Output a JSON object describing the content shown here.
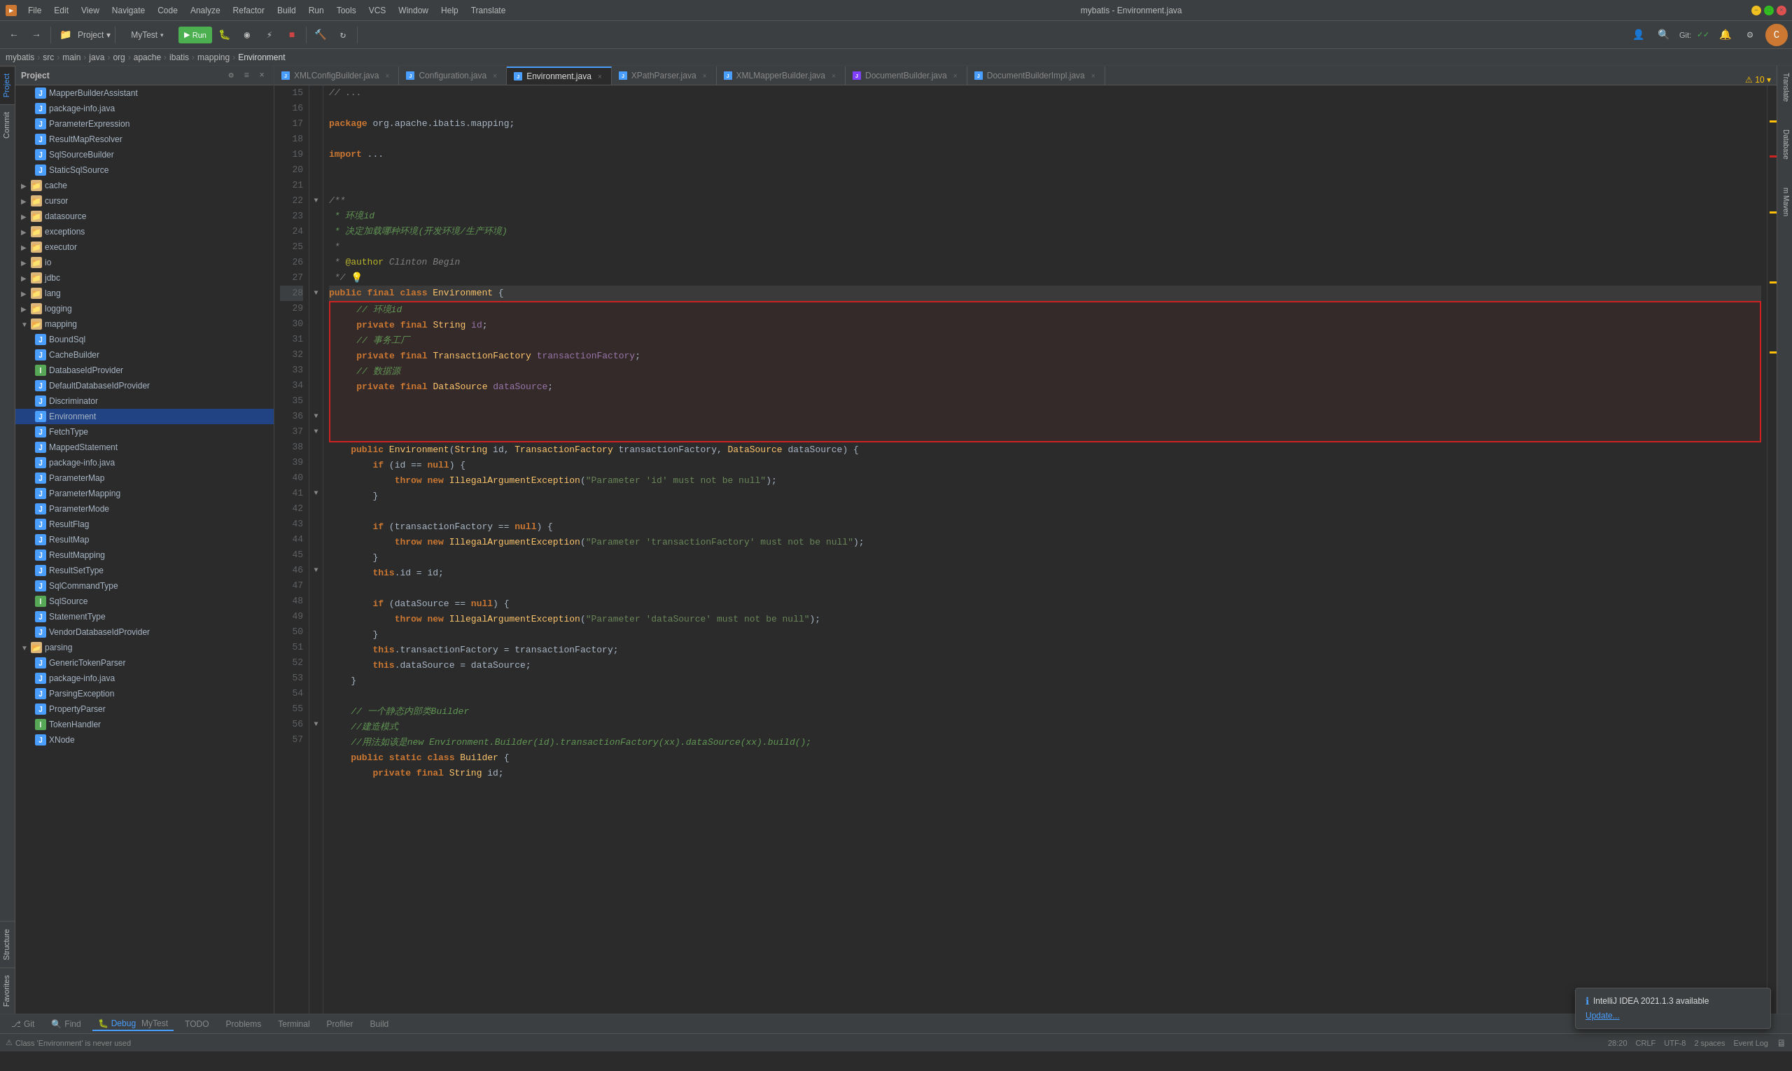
{
  "window": {
    "title": "mybatis - Environment.java",
    "app_name": "mybatis - Environment.java"
  },
  "menubar": {
    "items": [
      "File",
      "Edit",
      "View",
      "Navigate",
      "Code",
      "Analyze",
      "Refactor",
      "Build",
      "Run",
      "Tools",
      "VCS",
      "Window",
      "Help",
      "Translate"
    ]
  },
  "toolbar": {
    "project_dropdown": "MyTest",
    "git_label": "Git:",
    "run_config": "MyTest"
  },
  "breadcrumb": {
    "parts": [
      "mybatis",
      "src",
      "main",
      "java",
      "org",
      "apache",
      "ibatis",
      "mapping",
      "Environment"
    ]
  },
  "project_panel": {
    "title": "Project",
    "items": [
      {
        "label": "MapperBuilderAssistant",
        "type": "java",
        "depth": 1
      },
      {
        "label": "package-info.java",
        "type": "java",
        "depth": 1
      },
      {
        "label": "ParameterExpression",
        "type": "java",
        "depth": 1
      },
      {
        "label": "ResultMapResolver",
        "type": "java",
        "depth": 1
      },
      {
        "label": "SqlSourceBuilder",
        "type": "java",
        "depth": 1
      },
      {
        "label": "StaticSqlSource",
        "type": "java",
        "depth": 1
      },
      {
        "label": "cache",
        "type": "folder",
        "depth": 0,
        "collapsed": false
      },
      {
        "label": "cursor",
        "type": "folder",
        "depth": 0,
        "collapsed": true
      },
      {
        "label": "datasource",
        "type": "folder",
        "depth": 0,
        "collapsed": true
      },
      {
        "label": "exceptions",
        "type": "folder",
        "depth": 0,
        "collapsed": true
      },
      {
        "label": "executor",
        "type": "folder",
        "depth": 0,
        "collapsed": true
      },
      {
        "label": "io",
        "type": "folder",
        "depth": 0,
        "collapsed": true
      },
      {
        "label": "jdbc",
        "type": "folder",
        "depth": 0,
        "collapsed": true
      },
      {
        "label": "lang",
        "type": "folder",
        "depth": 0,
        "collapsed": true
      },
      {
        "label": "logging",
        "type": "folder",
        "depth": 0,
        "collapsed": true
      },
      {
        "label": "mapping",
        "type": "folder",
        "depth": 0,
        "collapsed": false
      },
      {
        "label": "BoundSql",
        "type": "java",
        "depth": 1
      },
      {
        "label": "CacheBuilder",
        "type": "java",
        "depth": 1
      },
      {
        "label": "DatabaseIdProvider",
        "type": "java-iface",
        "depth": 1
      },
      {
        "label": "DefaultDatabaseIdProvider",
        "type": "java",
        "depth": 1
      },
      {
        "label": "Discriminator",
        "type": "java",
        "depth": 1
      },
      {
        "label": "Environment",
        "type": "java",
        "depth": 1,
        "selected": true
      },
      {
        "label": "FetchType",
        "type": "java",
        "depth": 1
      },
      {
        "label": "MappedStatement",
        "type": "java",
        "depth": 1
      },
      {
        "label": "package-info.java",
        "type": "java",
        "depth": 1
      },
      {
        "label": "ParameterMap",
        "type": "java",
        "depth": 1
      },
      {
        "label": "ParameterMapping",
        "type": "java",
        "depth": 1
      },
      {
        "label": "ParameterMode",
        "type": "java",
        "depth": 1
      },
      {
        "label": "ResultFlag",
        "type": "java",
        "depth": 1
      },
      {
        "label": "ResultMap",
        "type": "java",
        "depth": 1
      },
      {
        "label": "ResultMapping",
        "type": "java",
        "depth": 1
      },
      {
        "label": "ResultSetType",
        "type": "java",
        "depth": 1
      },
      {
        "label": "SqlCommandType",
        "type": "java",
        "depth": 1
      },
      {
        "label": "SqlSource",
        "type": "java-iface",
        "depth": 1
      },
      {
        "label": "StatementType",
        "type": "java",
        "depth": 1
      },
      {
        "label": "VendorDatabaseIdProvider",
        "type": "java",
        "depth": 1
      },
      {
        "label": "parsing",
        "type": "folder",
        "depth": 0,
        "collapsed": false
      },
      {
        "label": "GenericTokenParser",
        "type": "java",
        "depth": 1
      },
      {
        "label": "package-info.java",
        "type": "java",
        "depth": 1
      },
      {
        "label": "ParsingException",
        "type": "java",
        "depth": 1
      },
      {
        "label": "PropertyParser",
        "type": "java",
        "depth": 1
      },
      {
        "label": "TokenHandler",
        "type": "java-iface",
        "depth": 1
      },
      {
        "label": "XNode",
        "type": "java",
        "depth": 1
      }
    ]
  },
  "editor_tabs": [
    {
      "label": "XMLConfigBuilder.java",
      "type": "java",
      "active": false,
      "color": "#4a9eff"
    },
    {
      "label": "Configuration.java",
      "type": "java",
      "active": false,
      "color": "#4a9eff"
    },
    {
      "label": "Environment.java",
      "type": "java",
      "active": true,
      "color": "#4a9eff"
    },
    {
      "label": "XPathParser.java",
      "type": "java",
      "active": false,
      "color": "#4a9eff"
    },
    {
      "label": "XMLMapperBuilder.java",
      "type": "java",
      "active": false,
      "color": "#4a9eff"
    },
    {
      "label": "DocumentBuilder.java",
      "type": "java",
      "active": false,
      "color": "#4a9eff"
    },
    {
      "label": "DocumentBuilderImpl.java",
      "type": "java",
      "active": false,
      "color": "#4a9eff"
    }
  ],
  "code": {
    "filename": "Environment.java",
    "lines": [
      {
        "num": 15,
        "content": "// ..."
      },
      {
        "num": 16,
        "content": ""
      },
      {
        "num": 17,
        "content": "package org.apache.ibatis.mapping;"
      },
      {
        "num": 18,
        "content": ""
      },
      {
        "num": 19,
        "content": "import ..."
      },
      {
        "num": 20,
        "content": ""
      },
      {
        "num": 21,
        "content": ""
      },
      {
        "num": 22,
        "content": "/**"
      },
      {
        "num": 23,
        "content": " * 环境id"
      },
      {
        "num": 24,
        "content": " * 决定加载哪种环境(开发环境/生产环境)"
      },
      {
        "num": 25,
        "content": " *"
      },
      {
        "num": 26,
        "content": " * @author Clinton Begin"
      },
      {
        "num": 27,
        "content": " */"
      },
      {
        "num": 28,
        "content": "public final class Environment {"
      },
      {
        "num": 29,
        "content": "    // 环境id"
      },
      {
        "num": 30,
        "content": "    private final String id;"
      },
      {
        "num": 31,
        "content": "    // 事务工厂"
      },
      {
        "num": 32,
        "content": "    private final TransactionFactory transactionFactory;"
      },
      {
        "num": 33,
        "content": "    // 数据源"
      },
      {
        "num": 34,
        "content": "    private final DataSource dataSource;"
      },
      {
        "num": 35,
        "content": ""
      },
      {
        "num": 36,
        "content": "    public Environment(String id, TransactionFactory transactionFactory, DataSource dataSource) {"
      },
      {
        "num": 37,
        "content": "        if (id == null) {"
      },
      {
        "num": 38,
        "content": "            throw new IllegalArgumentException(\"Parameter 'id' must not be null\");"
      },
      {
        "num": 39,
        "content": "        }"
      },
      {
        "num": 40,
        "content": ""
      },
      {
        "num": 41,
        "content": "        if (transactionFactory == null) {"
      },
      {
        "num": 42,
        "content": "            throw new IllegalArgumentException(\"Parameter 'transactionFactory' must not be null\");"
      },
      {
        "num": 43,
        "content": "        }"
      },
      {
        "num": 44,
        "content": "        this.id = id;"
      },
      {
        "num": 45,
        "content": ""
      },
      {
        "num": 46,
        "content": "        if (dataSource == null) {"
      },
      {
        "num": 47,
        "content": "            throw new IllegalArgumentException(\"Parameter 'dataSource' must not be null\");"
      },
      {
        "num": 48,
        "content": "        }"
      },
      {
        "num": 49,
        "content": "        this.transactionFactory = transactionFactory;"
      },
      {
        "num": 50,
        "content": "        this.dataSource = dataSource;"
      },
      {
        "num": 51,
        "content": "    }"
      },
      {
        "num": 52,
        "content": ""
      },
      {
        "num": 53,
        "content": "    // 一个静态内部类Builder"
      },
      {
        "num": 54,
        "content": "    //建造模式"
      },
      {
        "num": 55,
        "content": "    //用法如该是new Environment.Builder(id).transactionFactory(xx).dataSource(xx).build();"
      },
      {
        "num": 56,
        "content": "    public static class Builder {"
      },
      {
        "num": 57,
        "content": "        private final String id;"
      }
    ]
  },
  "status_bar": {
    "git": "Git",
    "find": "Find",
    "debug": "Debug",
    "todo": "TODO",
    "problems": "Problems",
    "terminal": "Terminal",
    "profiler": "Profiler",
    "build": "Build",
    "debug_tab": "MyTest",
    "line_col": "28:20",
    "encoding": "CRLF",
    "charset": "UTF-8",
    "indent": "2 spaces",
    "warning_count": "⚠ 10",
    "notification_title": "IntelliJ IDEA 2021.1.3 available",
    "notification_link": "Update...",
    "event_log": "Event Log",
    "class_warning": "Class 'Environment' is never used"
  },
  "right_panels": {
    "translate_label": "Translate",
    "database_label": "Database",
    "maven_label": "Maven"
  },
  "icons": {
    "fold": "▶",
    "unfold": "▼",
    "close": "×",
    "arrow_right": "❯",
    "info": "ℹ",
    "warning": "⚠",
    "run": "▶",
    "debug_icon": "🐛",
    "plus": "+",
    "minus": "−",
    "gear": "⚙",
    "search": "🔍"
  }
}
